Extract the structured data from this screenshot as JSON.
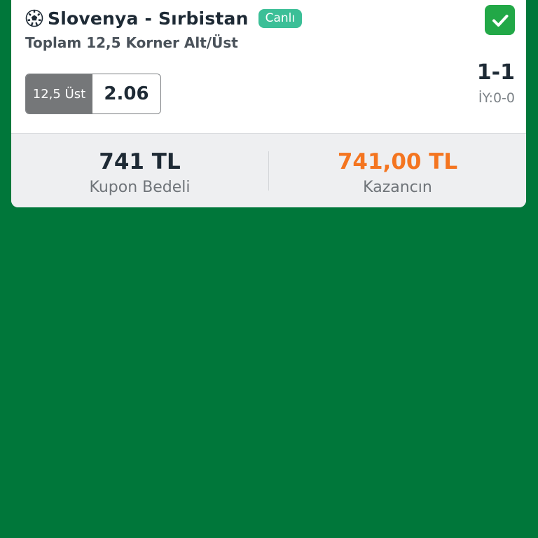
{
  "bet": {
    "match_title": "Slovenya - Sırbistan",
    "live_label": "Canlı",
    "market": "Toplam 12,5 Korner Alt/Üst",
    "selection": "12,5 Üst",
    "odd": "2.06",
    "score": "1-1",
    "halftime_score": "İY:0-0",
    "status": "won",
    "icons": {
      "sport": "soccer-ball-icon",
      "status": "check-icon"
    }
  },
  "summary": {
    "stake_amount": "741 TL",
    "stake_label": "Kupon Bedeli",
    "win_amount": "741,00 TL",
    "win_label": "Kazancın"
  },
  "colors": {
    "background": "#00773a",
    "live_badge": "#3bbf97",
    "success": "#22a847",
    "win_amount": "#f47520"
  }
}
